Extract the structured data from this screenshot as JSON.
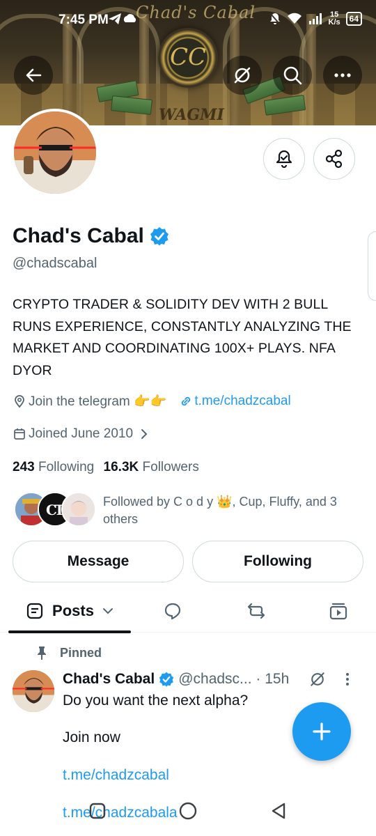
{
  "status_bar": {
    "time": "7:45 PM",
    "net_speed_value": "15",
    "net_speed_unit": "K/s",
    "battery": "64"
  },
  "banner": {
    "title": "Chad's Cabal",
    "emblem": "CC",
    "subtitle": "WAGMI"
  },
  "profile": {
    "name": "Chad's Cabal",
    "handle": "@chadscabal",
    "bio": "CRYPTO TRADER & SOLIDITY DEV WITH 2 BULL RUNS EXPERIENCE, CONSTANTLY ANALYZING THE MARKET AND COORDINATING 100X+ PLAYS. NFA DYOR",
    "location": "Join the telegram 👉👉",
    "website": "t.me/chadzcabal",
    "joined": "Joined June 2010",
    "following_count": "243",
    "following_label": "Following",
    "followers_count": "16.3K",
    "followers_label": "Followers",
    "followed_by": "Followed by C o d y 👑, Cup, Fluffy, and 3 others"
  },
  "actions": {
    "message": "Message",
    "following": "Following"
  },
  "tabs": {
    "posts": "Posts"
  },
  "post": {
    "pinned_label": "Pinned",
    "author": "Chad's Cabal",
    "handle_time": "@chadsc... · 15h",
    "line1": "Do you want the next alpha?",
    "line2": "Join now",
    "link1": "t.me/chadzcabal",
    "link2": "t.me/chadzcabala"
  },
  "colors": {
    "accent": "#1d9bf0",
    "text": "#0f1419",
    "muted": "#536471"
  }
}
